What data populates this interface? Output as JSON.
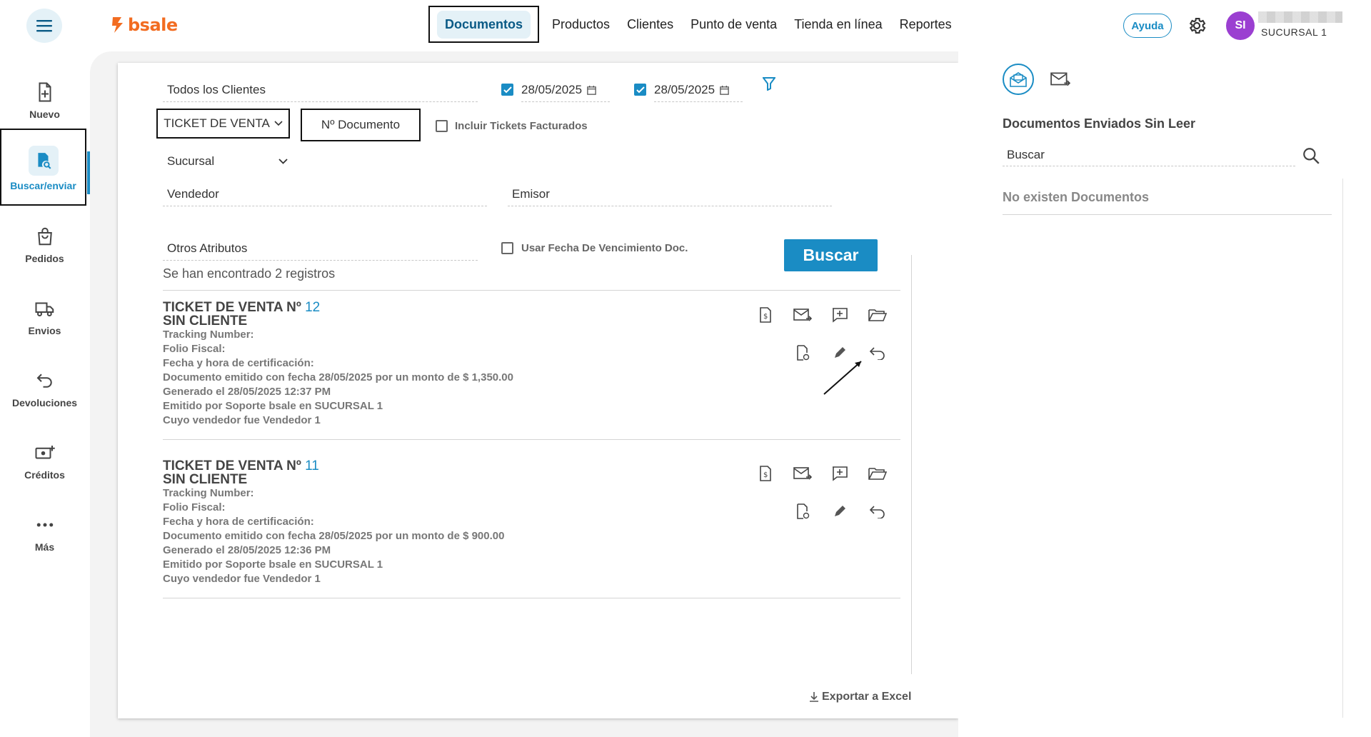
{
  "header": {
    "logo_text": "bsale",
    "nav": [
      "Documentos",
      "Productos",
      "Clientes",
      "Punto de venta",
      "Tienda en línea",
      "Reportes"
    ],
    "help_label": "Ayuda",
    "avatar_initials": "SI",
    "branch": "SUCURSAL 1"
  },
  "sidebar": {
    "items": [
      {
        "label": "Nuevo",
        "icon": "new-document-icon"
      },
      {
        "label": "Buscar/enviar",
        "icon": "search-document-icon"
      },
      {
        "label": "Pedidos",
        "icon": "shopping-bag-icon"
      },
      {
        "label": "Envios",
        "icon": "truck-icon"
      },
      {
        "label": "Devoluciones",
        "icon": "return-arrow-icon"
      },
      {
        "label": "Créditos",
        "icon": "money-plus-icon"
      },
      {
        "label": "Más",
        "icon": "more-dots-icon"
      }
    ]
  },
  "filters": {
    "clients": "Todos los Clientes",
    "date_from": "28/05/2025",
    "date_to": "28/05/2025",
    "doc_type": "TICKET DE VENTA",
    "doc_number_placeholder": "Nº Documento",
    "include_invoiced_label": "Incluir Tickets Facturados",
    "branch_label": "Sucursal",
    "seller_label": "Vendedor",
    "issuer_label": "Emisor",
    "other_attrs_label": "Otros Atributos",
    "due_date_label": "Usar Fecha De Vencimiento Doc.",
    "search_button": "Buscar"
  },
  "results": {
    "summary": "Se han encontrado 2 registros",
    "docs": [
      {
        "title": "TICKET DE VENTA Nº",
        "number": "12",
        "client": "SIN CLIENTE",
        "lines": [
          "Tracking Number:",
          "Folio Fiscal:",
          "Fecha y hora de certificación:",
          "Documento emitido con fecha 28/05/2025 por un monto de $ 1,350.00",
          "Generado el 28/05/2025 12:37 PM",
          "Emitido por Soporte bsale en SUCURSAL 1",
          "Cuyo vendedor fue Vendedor 1"
        ]
      },
      {
        "title": "TICKET DE VENTA Nº",
        "number": "11",
        "client": "SIN CLIENTE",
        "lines": [
          "Tracking Number:",
          "Folio Fiscal:",
          "Fecha y hora de certificación:",
          "Documento emitido con fecha 28/05/2025 por un monto de $ 900.00",
          "Generado el 28/05/2025 12:36 PM",
          "Emitido por Soporte bsale en SUCURSAL 1",
          "Cuyo vendedor fue Vendedor 1"
        ]
      }
    ],
    "export_label": "Exportar a Excel"
  },
  "right_panel": {
    "title": "Documentos Enviados Sin Leer",
    "search_placeholder": "Buscar",
    "empty_text": "No existen Documentos"
  },
  "colors": {
    "accent": "#1a8cc4",
    "brand": "#f26c21",
    "avatar": "#9b3fd1"
  }
}
